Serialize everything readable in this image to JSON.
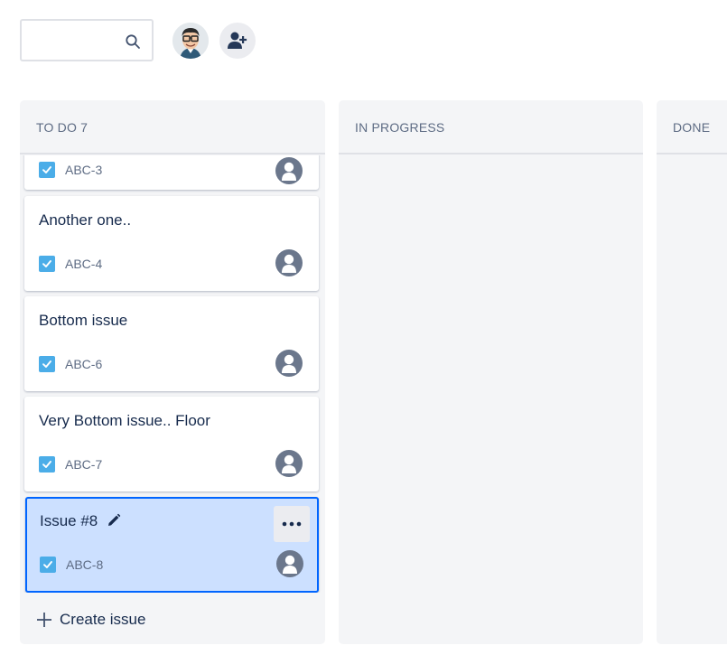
{
  "search": {
    "placeholder": "",
    "icon": "search-icon"
  },
  "header": {
    "avatar_icon": "user-avatar",
    "add_people_icon": "add-person-icon"
  },
  "columns": [
    {
      "title": "TO DO 7"
    },
    {
      "title": "IN PROGRESS"
    },
    {
      "title": "DONE"
    }
  ],
  "cards": [
    {
      "summary": "",
      "key": "ABC-3"
    },
    {
      "summary": "Another one..",
      "key": "ABC-4"
    },
    {
      "summary": "Bottom issue",
      "key": "ABC-6"
    },
    {
      "summary": "Very Bottom issue.. Floor",
      "key": "ABC-7"
    },
    {
      "summary": "Issue #8",
      "key": "ABC-8",
      "selected": true
    }
  ],
  "create_issue": {
    "label": "Create issue"
  },
  "colors": {
    "accent": "#0065FF",
    "selected_bg": "#CCE0FF",
    "column_bg": "#F4F5F7",
    "task_icon": "#4BADE8"
  }
}
